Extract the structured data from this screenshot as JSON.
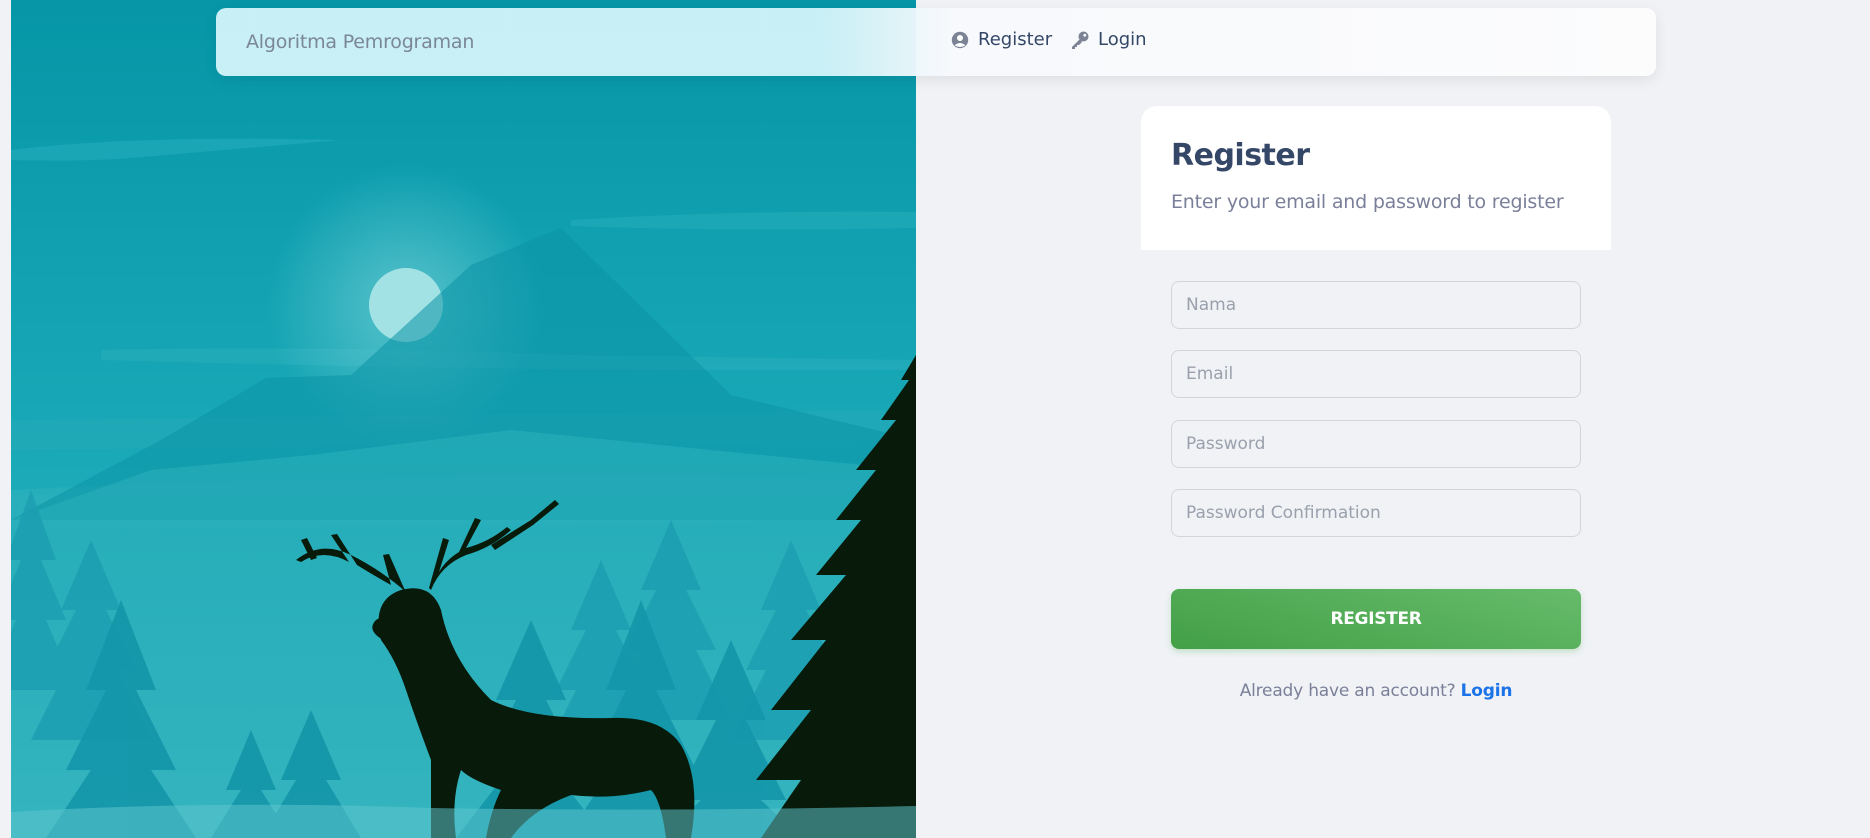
{
  "navbar": {
    "brand": "Algoritma Pemrograman",
    "links": [
      {
        "label": "Register",
        "icon": "user-circle-icon"
      },
      {
        "label": "Login",
        "icon": "key-icon"
      }
    ]
  },
  "card": {
    "title": "Register",
    "subtitle": "Enter your email and password to register"
  },
  "form": {
    "nama_placeholder": "Nama",
    "email_placeholder": "Email",
    "password_placeholder": "Password",
    "password_confirmation_placeholder": "Password Confirmation",
    "submit_label": "REGISTER"
  },
  "footer": {
    "prompt": "Already have an account?",
    "login_label": "Login"
  },
  "colors": {
    "accent": "#43a047",
    "link": "#1a73e8",
    "heading": "#344767",
    "illustration_bg": "#0799a9"
  }
}
